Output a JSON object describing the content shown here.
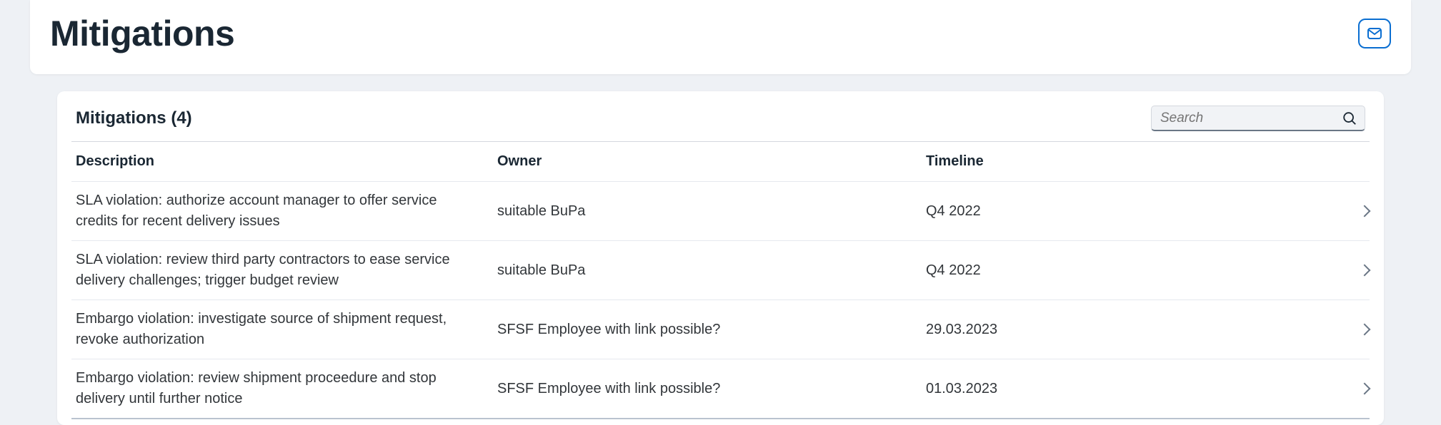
{
  "header": {
    "title": "Mitigations"
  },
  "table": {
    "title": "Mitigations (4)",
    "search_placeholder": "Search",
    "columns": {
      "description": "Description",
      "owner": "Owner",
      "timeline": "Timeline"
    },
    "rows": [
      {
        "description": "SLA violation: authorize account manager to offer service credits for recent delivery issues",
        "owner": "suitable BuPa",
        "timeline": "Q4 2022"
      },
      {
        "description": "SLA violation: review third party contractors to ease service delivery challenges; trigger budget review",
        "owner": "suitable BuPa",
        "timeline": "Q4 2022"
      },
      {
        "description": "Embargo violation: investigate source of shipment request, revoke authorization",
        "owner": "SFSF Employee with link possible?",
        "timeline": "29.03.2023"
      },
      {
        "description": "Embargo violation: review shipment proceedure and stop delivery until further notice",
        "owner": "SFSF Employee with link possible?",
        "timeline": "01.03.2023"
      }
    ]
  }
}
